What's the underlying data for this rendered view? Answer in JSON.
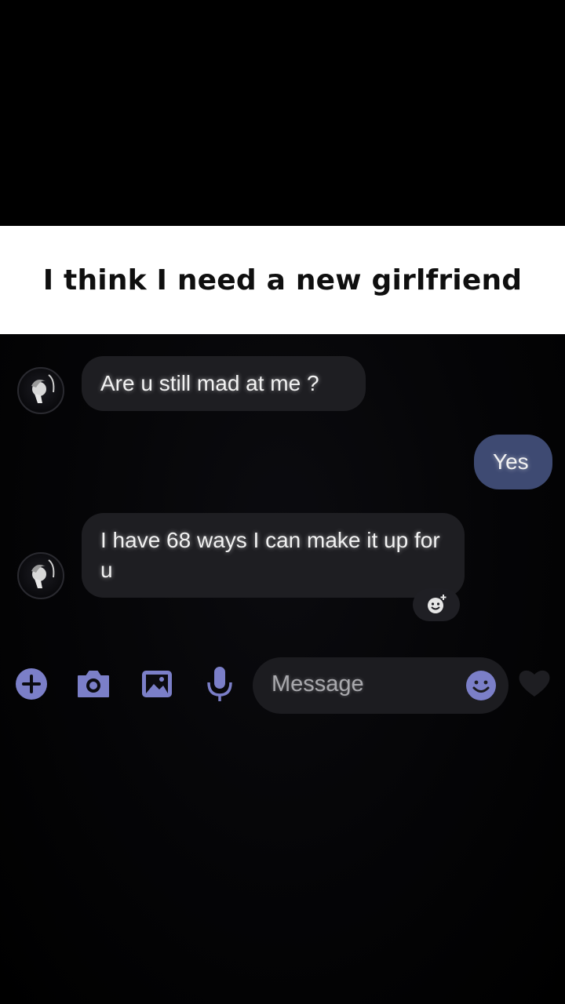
{
  "caption": {
    "text": "I think I need a new girlfriend"
  },
  "chat": {
    "messages": [
      {
        "side": "received",
        "text": "Are u still mad at me ?"
      },
      {
        "side": "sent",
        "text": "Yes"
      },
      {
        "side": "received",
        "text": "I have 68 ways I can make it up for u"
      }
    ]
  },
  "composer": {
    "placeholder": "Message",
    "icons": [
      "plus-icon",
      "camera-icon",
      "gallery-icon",
      "microphone-icon",
      "emoji-icon",
      "heart-icon"
    ]
  },
  "colors": {
    "accent": "#7b7fc8",
    "sent_bubble": "#3e4a72",
    "received_bubble": "#1e1e22",
    "caption_band": "#ffffff"
  }
}
